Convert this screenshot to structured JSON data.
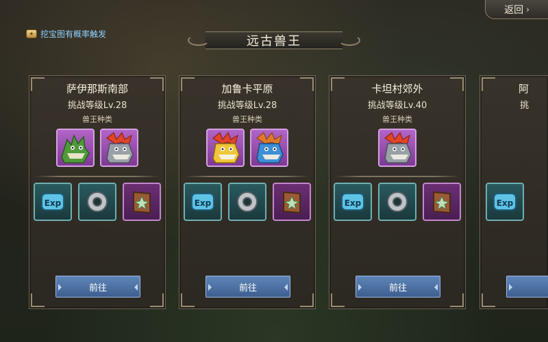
{
  "header": {
    "back_label": "返回",
    "title": "远古兽王",
    "hint_text": "挖宝图有概率触发"
  },
  "cards": [
    {
      "region": "萨伊那斯南部",
      "level": "挑战等级Lv.28",
      "type_label": "兽王种类",
      "monsters": [
        "green-dragon-icon",
        "grey-dragon-icon"
      ],
      "rewards": [
        "exp-icon",
        "silver-ring-icon",
        "skill-book-icon"
      ],
      "go_label": "前往"
    },
    {
      "region": "加鲁卡平原",
      "level": "挑战等级Lv.28",
      "type_label": "兽王种类",
      "monsters": [
        "yellow-dragon-icon",
        "blue-dragon-icon"
      ],
      "rewards": [
        "exp-icon",
        "silver-ring-icon",
        "skill-book-icon"
      ],
      "go_label": "前往"
    },
    {
      "region": "卡坦村郊外",
      "level": "挑战等级Lv.40",
      "type_label": "兽王种类",
      "monsters": [
        "grey-dragon-icon"
      ],
      "rewards": [
        "exp-icon",
        "silver-ring-icon",
        "skill-book-icon"
      ],
      "go_label": "前往"
    },
    {
      "region": "阿",
      "level": "挑",
      "rewards": [
        "exp-icon"
      ]
    }
  ],
  "colors": {
    "accent_blue_button": "#4a6fa3",
    "hint_blue": "#8fd0ff",
    "purple_slot": "#7d3a95",
    "teal_slot": "#1f4a4e"
  }
}
